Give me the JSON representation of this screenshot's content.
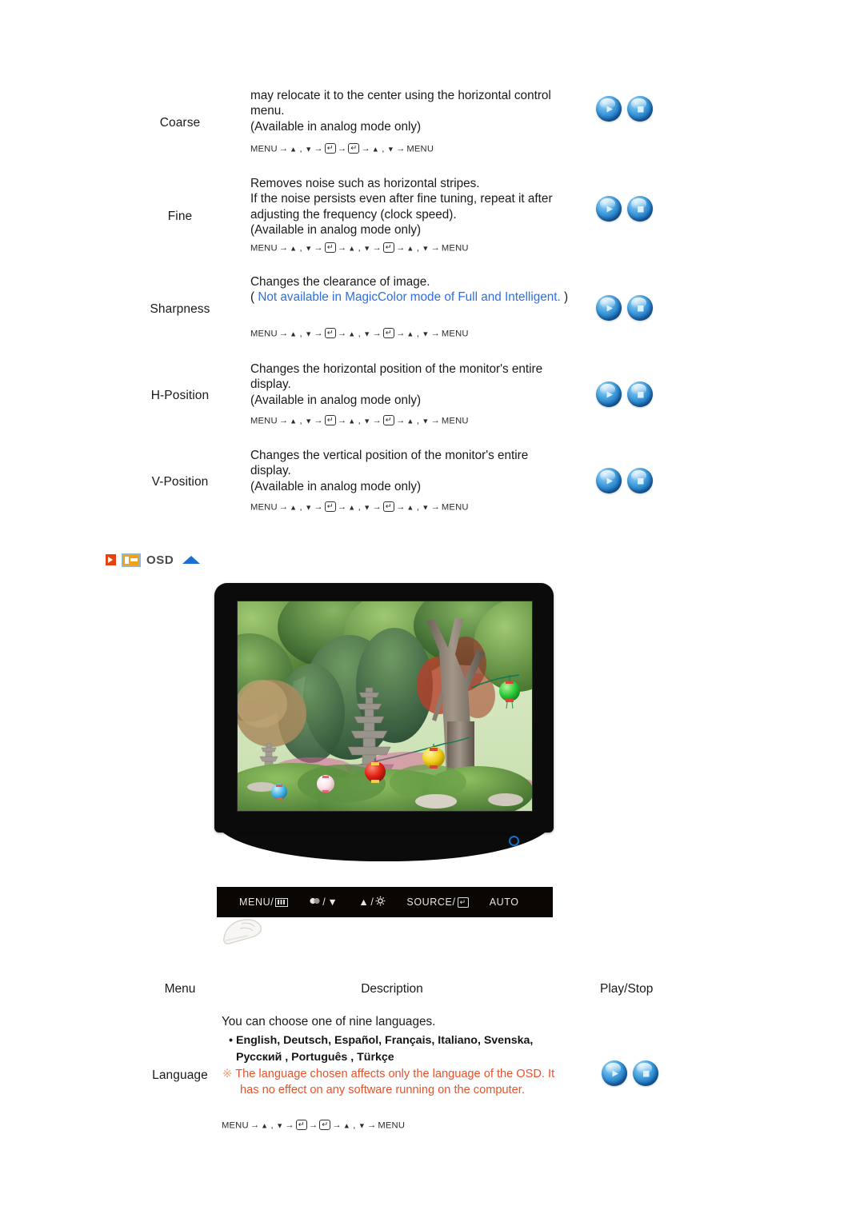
{
  "page": {
    "osd_section_title": "OSD"
  },
  "nav_parts": {
    "menu": "MENU",
    "arrow": "→",
    "up": "▲",
    "down": "▼",
    "comma": ",",
    "enter": "↵"
  },
  "rows": [
    {
      "label": "Coarse",
      "desc_lines": [
        "may relocate it to the center using the horizontal control",
        "menu.",
        "(Available in analog mode only)"
      ],
      "nav_type": "short",
      "buttons": {
        "play": "Play",
        "stop": "Stop"
      }
    },
    {
      "label": "Fine",
      "desc_lines": [
        "Removes noise such as horizontal stripes.",
        "If the noise persists even after fine tuning, repeat it after",
        "adjusting the frequency (clock speed).",
        "(Available in analog mode only)"
      ],
      "nav_type": "long",
      "buttons": {
        "play": "Play",
        "stop": "Stop"
      }
    },
    {
      "label": "Sharpness",
      "desc_lines": [
        "Changes the clearance of image."
      ],
      "blue_note_open": "(",
      "blue_note": "Not available in MagicColor mode of Full and Intelligent.",
      "blue_note_close": ")",
      "nav_type": "long",
      "buttons": {
        "play": "Play",
        "stop": "Stop"
      }
    },
    {
      "label": "H-Position",
      "desc_lines": [
        "Changes the horizontal position of the monitor's entire",
        "display.",
        "(Available in analog mode only)"
      ],
      "nav_type": "long",
      "buttons": {
        "play": "Play",
        "stop": "Stop"
      }
    },
    {
      "label": "V-Position",
      "desc_lines": [
        "Changes the vertical position of the monitor's entire",
        "display.",
        "(Available in analog mode only)"
      ],
      "nav_type": "long",
      "buttons": {
        "play": "Play",
        "stop": "Stop"
      }
    }
  ],
  "monitor_controls": [
    {
      "label": "MENU/",
      "icon": "menu-bars-icon"
    },
    {
      "label": "/",
      "icon": "brightness-contrast-down-icon"
    },
    {
      "label": "/",
      "icon": "up-brightness-icon"
    },
    {
      "label": "SOURCE/",
      "icon": "enter-key-icon"
    },
    {
      "label": "AUTO",
      "icon": ""
    }
  ],
  "monitor_controls_text": {
    "menu": "MENU/",
    "down": "/",
    "up": "/",
    "source": "SOURCE/",
    "auto": "AUTO"
  },
  "table": {
    "headers": {
      "menu": "Menu",
      "description": "Description",
      "play_stop": "Play/Stop"
    },
    "language_row": {
      "label": "Language",
      "intro": "You can choose one of nine languages.",
      "languages_line1": "English, Deutsch, Español, Français,  Italiano, Svenska,",
      "languages_line2": "Русский , Português , Türkçe",
      "warning_symbol": "※",
      "warning_line1": "The language chosen affects only the language of the OSD. It",
      "warning_line2": "has no effect on any software running on the computer.",
      "nav_type": "short",
      "buttons": {
        "play": "Play",
        "stop": "Stop"
      }
    }
  },
  "colors": {
    "blue_note": "#2d6fe0",
    "warning_red": "#e8512a",
    "osd_accent_blue": "#1b6fd4",
    "osd_icon_orange": "#f3a01b",
    "red_marker": "#e8410f",
    "power_led": "#1273c9"
  }
}
